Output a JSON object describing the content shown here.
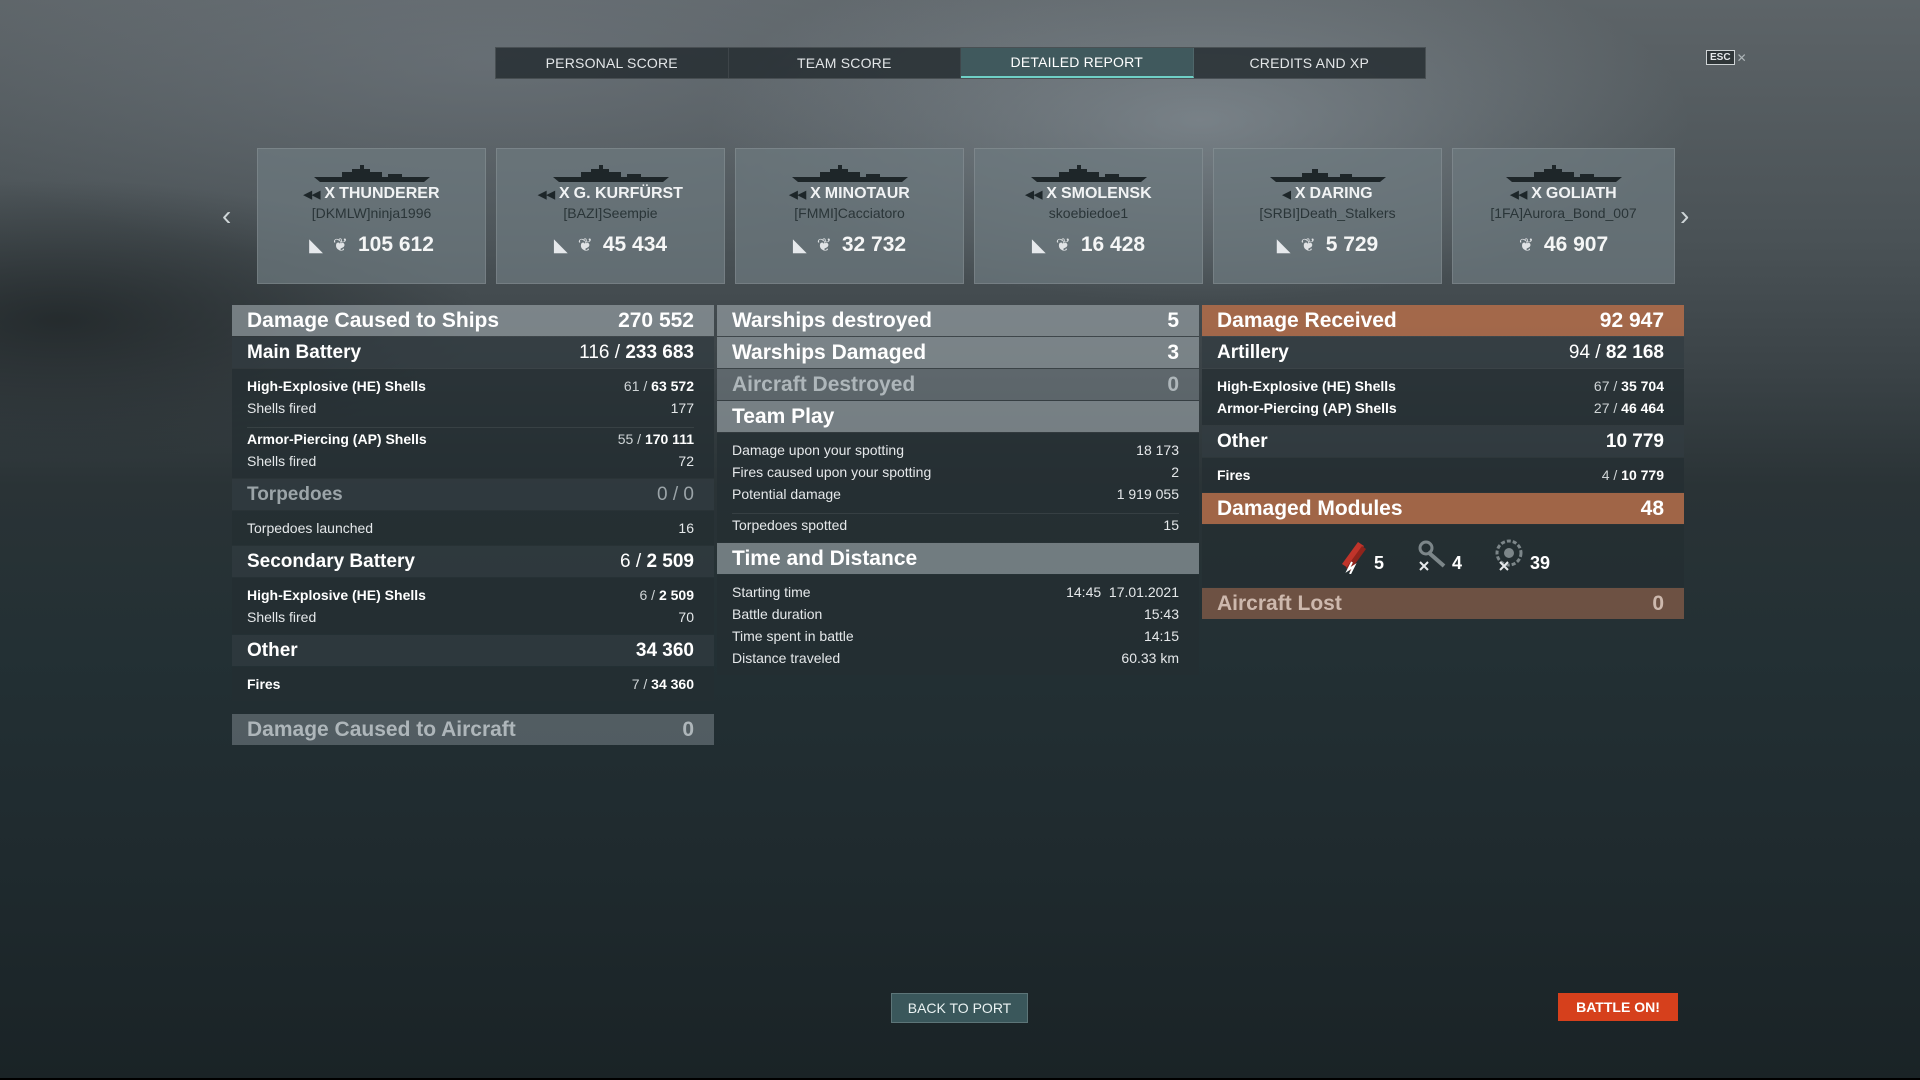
{
  "tabs": [
    "PERSONAL SCORE",
    "TEAM SCORE",
    "DETAILED REPORT",
    "CREDITS AND XP"
  ],
  "active_tab": "DETAILED REPORT",
  "esc_label": "ESC",
  "ships": [
    {
      "tier": "X",
      "name": "THUNDERER",
      "player": "[DKMLW]ninja1996",
      "value": "105 612"
    },
    {
      "tier": "X",
      "name": "G. KURFÜRST",
      "player": "[BAZI]Seempie",
      "value": "45 434"
    },
    {
      "tier": "X",
      "name": "MINOTAUR",
      "player": "[FMMI]Cacciatoro",
      "value": "32 732"
    },
    {
      "tier": "X",
      "name": "SMOLENSK",
      "player": "skoebiedoe1",
      "value": "16 428"
    },
    {
      "tier": "X",
      "name": "DARING",
      "player": "[SRBI]Death_Stalkers",
      "value": "5 729"
    },
    {
      "tier": "X",
      "name": "GOLIATH",
      "player": "[1FA]Aurora_Bond_007",
      "value": "46 907"
    }
  ],
  "left": {
    "damage_ships": {
      "label": "Damage Caused to Ships",
      "value": "270 552"
    },
    "main_battery": {
      "label": "Main Battery",
      "hits": "116 /",
      "value": "233 683"
    },
    "mb_he": {
      "label": "High-Explosive (HE) Shells",
      "hits": "61 /",
      "value": "63 572"
    },
    "mb_he_fired": {
      "label": "Shells fired",
      "value": "177"
    },
    "mb_ap": {
      "label": "Armor-Piercing (AP) Shells",
      "hits": "55 /",
      "value": "170 111"
    },
    "mb_ap_fired": {
      "label": "Shells fired",
      "value": "72"
    },
    "torpedoes": {
      "label": "Torpedoes",
      "value": "0 / 0"
    },
    "torp_launched": {
      "label": "Torpedoes launched",
      "value": "16"
    },
    "secondary": {
      "label": "Secondary Battery",
      "hits": "6 /",
      "value": "2 509"
    },
    "sec_he": {
      "label": "High-Explosive (HE) Shells",
      "hits": "6 /",
      "value": "2 509"
    },
    "sec_fired": {
      "label": "Shells fired",
      "value": "70"
    },
    "other": {
      "label": "Other",
      "value": "34 360"
    },
    "fires": {
      "label": "Fires",
      "hits": "7 /",
      "value": "34 360"
    },
    "damage_aircraft": {
      "label": "Damage Caused to Aircraft",
      "value": "0"
    }
  },
  "mid": {
    "destroyed": {
      "label": "Warships destroyed",
      "value": "5"
    },
    "damaged": {
      "label": "Warships Damaged",
      "value": "3"
    },
    "aircraft": {
      "label": "Aircraft Destroyed",
      "value": "0"
    },
    "team_play": {
      "label": "Team Play"
    },
    "spotting_damage": {
      "label": "Damage upon your spotting",
      "value": "18 173"
    },
    "spotting_fires": {
      "label": "Fires caused upon your spotting",
      "value": "2"
    },
    "potential": {
      "label": "Potential damage",
      "value": "1 919 055"
    },
    "torp_spotted": {
      "label": "Torpedoes spotted",
      "value": "15"
    },
    "time_distance": {
      "label": "Time and Distance"
    },
    "start": {
      "label": "Starting time",
      "value": "14:45  17.01.2021"
    },
    "duration": {
      "label": "Battle duration",
      "value": "15:43"
    },
    "time_spent": {
      "label": "Time spent in battle",
      "value": "14:15"
    },
    "distance": {
      "label": "Distance traveled",
      "value": "60.33 km"
    }
  },
  "right": {
    "received": {
      "label": "Damage Received",
      "value": "92 947"
    },
    "artillery": {
      "label": "Artillery",
      "hits": "94 /",
      "value": "82 168"
    },
    "art_he": {
      "label": "High-Explosive (HE) Shells",
      "hits": "67 /",
      "value": "35 704"
    },
    "art_ap": {
      "label": "Armor-Piercing (AP) Shells",
      "hits": "27 /",
      "value": "46 464"
    },
    "other": {
      "label": "Other",
      "value": "10 779"
    },
    "fires": {
      "label": "Fires",
      "hits": "4 /",
      "value": "10 779"
    },
    "modules": {
      "label": "Damaged Modules",
      "value": "48"
    },
    "module_counts": {
      "flooded": "5",
      "turret": "4",
      "engine": "39"
    },
    "aircraft_lost": {
      "label": "Aircraft Lost",
      "value": "0"
    }
  },
  "buttons": {
    "back": "BACK TO PORT",
    "battle": "BATTLE ON!"
  },
  "colors": {
    "accent": "#6fd0c6",
    "battle": "#d6401c",
    "orange_header": "#b06c4a"
  }
}
